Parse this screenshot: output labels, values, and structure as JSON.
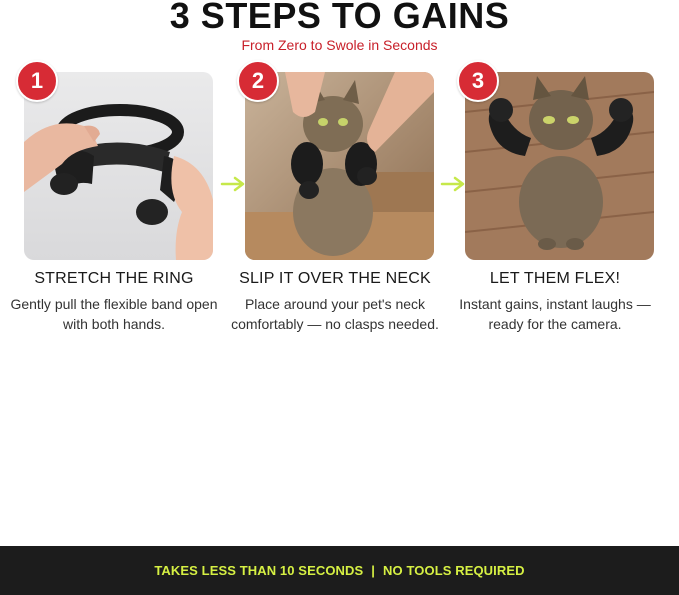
{
  "header": {
    "title": "3 STEPS TO GAINS",
    "subtitle": "From Zero to Swole in Seconds"
  },
  "steps": [
    {
      "number": "1",
      "title": "STRETCH THE RING",
      "description": "Gently pull the flexible band open with both hands."
    },
    {
      "number": "2",
      "title": "SLIP IT OVER THE NECK",
      "description": "Place around your pet's neck comfortably — no clasps needed."
    },
    {
      "number": "3",
      "title": "LET THEM FLEX!",
      "description": "Instant gains, instant laughs — ready for the camera."
    }
  ],
  "footer": {
    "left": "TAKES LESS THAN 10 SECONDS",
    "separator": "|",
    "right": "NO TOOLS REQUIRED"
  },
  "colors": {
    "accent_red": "#d72b35",
    "subtitle_red": "#c8202a",
    "footer_bg": "#1c1c1c",
    "footer_text": "#d6f043",
    "arrow": "#c6e84a"
  },
  "icons": {
    "arrow": "arrow-right-icon"
  }
}
